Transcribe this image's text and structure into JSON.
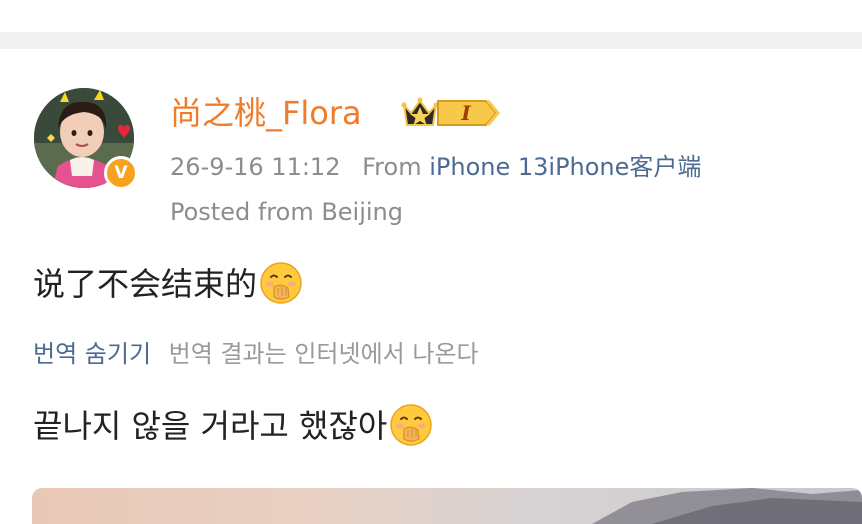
{
  "post": {
    "username": "尚之桃_Flora",
    "level": "I",
    "timestamp": "26-9-16 11:12",
    "from_label": "From",
    "device": "iPhone 13iPhone客户端",
    "location": "Posted from Beijing",
    "text": "说了不会结束的",
    "translate_link": "번역 숨기기",
    "translate_note": "번역 결과는 인터넷에서 나온다",
    "translated_text": "끝나지 않을 거라고 했잖아",
    "verified_badge": "V"
  },
  "icons": {
    "crown": "crown-icon",
    "emoji": "hand-over-mouth-emoji",
    "verified": "verified-v-icon"
  },
  "colors": {
    "username": "#f07c2b",
    "link": "#4d6a93",
    "muted": "#8d8d8d",
    "badge": "#f6a21c"
  }
}
